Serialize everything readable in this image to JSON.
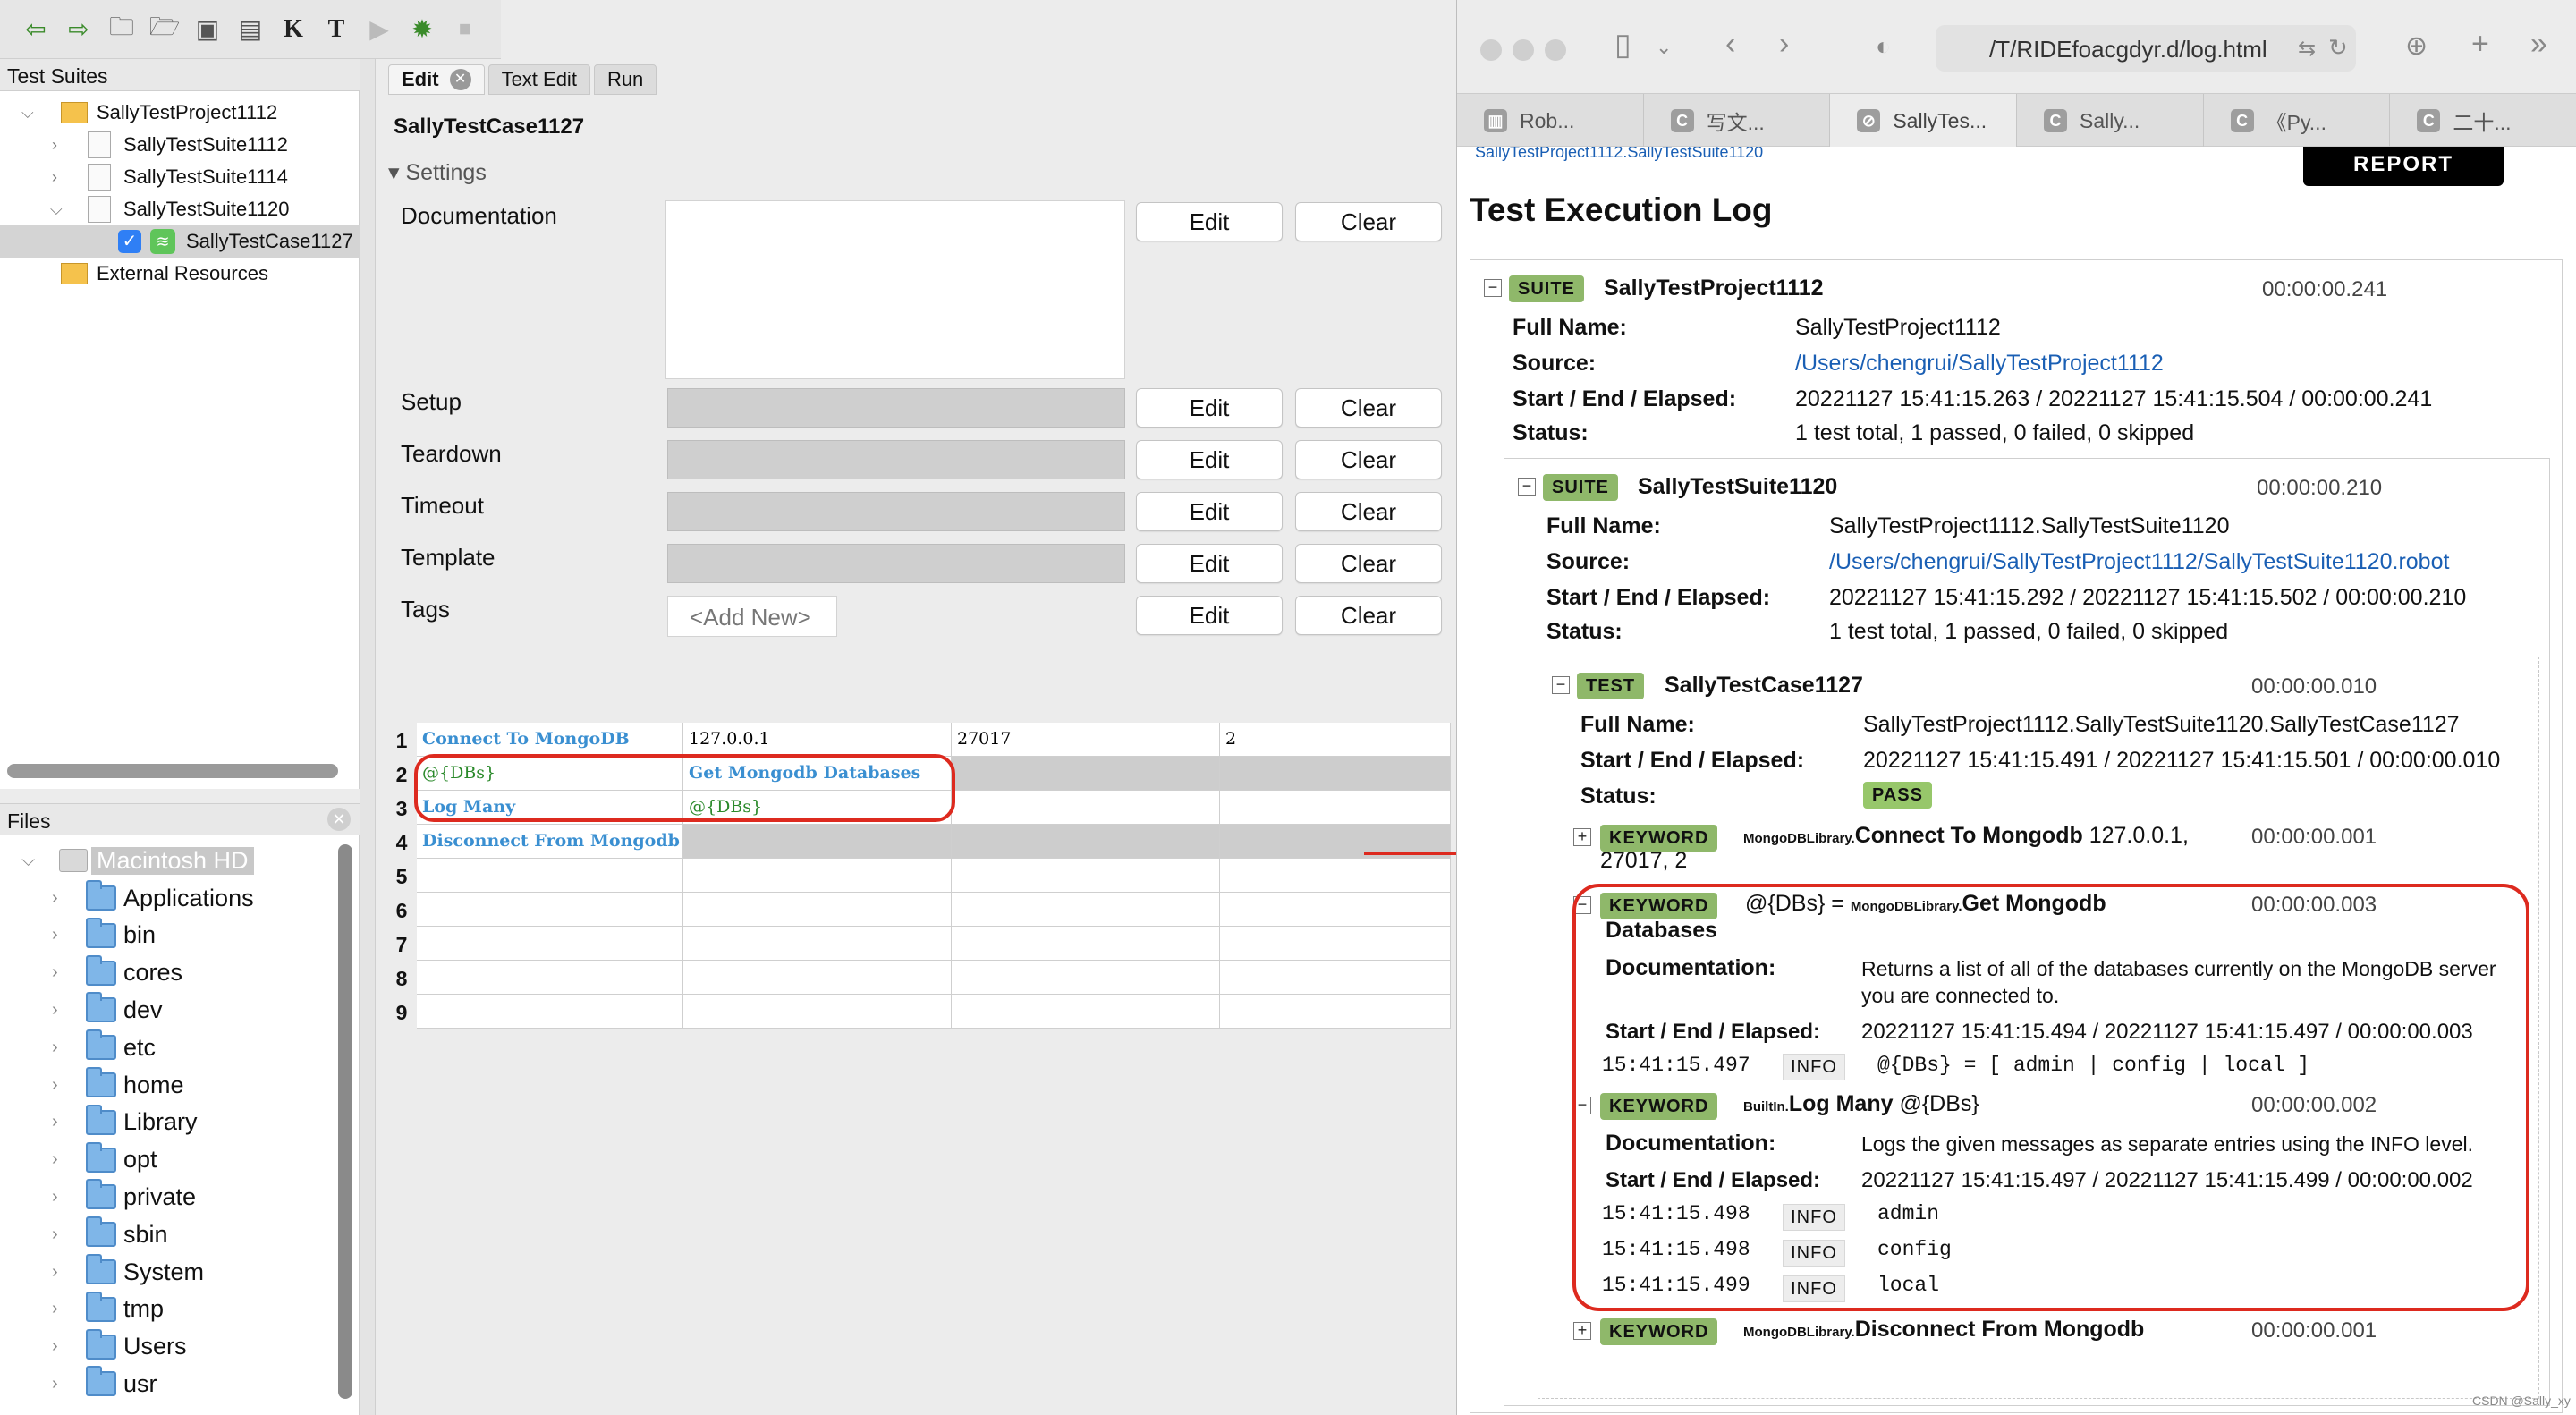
{
  "toolbar": {
    "icons": [
      "back-arrow-icon",
      "forward-arrow-icon",
      "open-folder-icon",
      "open-directory-icon",
      "save-icon",
      "save-all-icon",
      "keyword-search-icon",
      "text-format-icon",
      "play-icon",
      "debug-bug-icon",
      "stop-icon"
    ],
    "k_label": "K",
    "t_label": "T"
  },
  "test_suites": {
    "header": "Test Suites",
    "items": [
      {
        "label": "SallyTestProject1112",
        "level": 0
      },
      {
        "label": "SallyTestSuite1112",
        "level": 1
      },
      {
        "label": "SallyTestSuite1114",
        "level": 1
      },
      {
        "label": "SallyTestSuite1120",
        "level": 1
      },
      {
        "label": "SallyTestCase1127",
        "level": 2
      },
      {
        "label": "External Resources",
        "level": 0
      }
    ]
  },
  "files": {
    "header": "Files",
    "root": "Macintosh HD",
    "items": [
      "Applications",
      "bin",
      "cores",
      "dev",
      "etc",
      "home",
      "Library",
      "opt",
      "private",
      "sbin",
      "System",
      "tmp",
      "Users",
      "usr"
    ]
  },
  "editor": {
    "tabs": [
      "Edit",
      "Text Edit",
      "Run"
    ],
    "title": "SallyTestCase1127",
    "settings_label": "Settings",
    "settings": [
      "Documentation",
      "Setup",
      "Teardown",
      "Timeout",
      "Template",
      "Tags"
    ],
    "edit_label": "Edit",
    "clear_label": "Clear",
    "tags_placeholder": "<Add New>"
  },
  "grid": {
    "rows": [
      {
        "n": "1",
        "c": [
          {
            "t": "Connect To MongoDB",
            "s": "kw"
          },
          {
            "t": "127.0.0.1",
            "s": "num"
          },
          {
            "t": "27017",
            "s": "num"
          },
          {
            "t": "2",
            "s": "num"
          }
        ]
      },
      {
        "n": "2",
        "c": [
          {
            "t": "@{DBs}",
            "s": "var"
          },
          {
            "t": "Get Mongodb Databases",
            "s": "kw"
          },
          {
            "t": "",
            "s": "shade"
          },
          {
            "t": "",
            "s": "shade"
          }
        ]
      },
      {
        "n": "3",
        "c": [
          {
            "t": "Log Many",
            "s": "kw"
          },
          {
            "t": "@{DBs}",
            "s": "var"
          },
          {
            "t": "",
            "s": ""
          },
          {
            "t": "",
            "s": ""
          }
        ]
      },
      {
        "n": "4",
        "c": [
          {
            "t": "Disconnect From Mongodb",
            "s": "kw"
          },
          {
            "t": "",
            "s": "shade"
          },
          {
            "t": "",
            "s": "shade"
          },
          {
            "t": "",
            "s": "shade"
          }
        ]
      },
      {
        "n": "5",
        "c": []
      },
      {
        "n": "6",
        "c": []
      },
      {
        "n": "7",
        "c": []
      },
      {
        "n": "8",
        "c": []
      },
      {
        "n": "9",
        "c": []
      }
    ]
  },
  "browser": {
    "url": "/T/RIDEfoacgdyr.d/log.html",
    "tabs": [
      "Rob...",
      "写文...",
      "SallyTes...",
      "Sally...",
      "《Py...",
      "二十..."
    ]
  },
  "log": {
    "report_label": "REPORT",
    "top_link": "SallyTestProject1112.SallyTestSuite1120",
    "title": "Test Execution Log",
    "suite_badge": "SUITE",
    "test_badge": "TEST",
    "keyword_badge": "KEYWORD",
    "info_badge": "INFO",
    "pass_badge": "PASS",
    "k_full_name": "Full Name:",
    "k_source": "Source:",
    "k_start": "Start / End / Elapsed:",
    "k_status": "Status:",
    "k_doc": "Documentation:",
    "suite1": {
      "name": "SallyTestProject1112",
      "elapsed": "00:00:00.241",
      "full_name": "SallyTestProject1112",
      "source": "/Users/chengrui/SallyTestProject1112",
      "times": "20221127 15:41:15.263 / 20221127 15:41:15.504 / 00:00:00.241",
      "status": "1 test total, 1 passed, 0 failed, 0 skipped"
    },
    "suite2": {
      "name": "SallyTestSuite1120",
      "elapsed": "00:00:00.210",
      "full_name": "SallyTestProject1112.SallyTestSuite1120",
      "source": "/Users/chengrui/SallyTestProject1112/SallyTestSuite1120.robot",
      "times": "20221127 15:41:15.292 / 20221127 15:41:15.502 / 00:00:00.210",
      "status": "1 test total, 1 passed, 0 failed, 0 skipped"
    },
    "test": {
      "name": "SallyTestCase1127",
      "elapsed": "00:00:00.010",
      "full_name": "SallyTestProject1112.SallyTestSuite1120.SallyTestCase1127",
      "times": "20221127 15:41:15.491 / 20221127 15:41:15.501 / 00:00:00.010"
    },
    "kw1": {
      "lib": "MongoDBLibrary.",
      "name": "Connect To Mongodb",
      "args": "127.0.0.1,",
      "args2": "27017, 2",
      "elapsed": "00:00:00.001"
    },
    "kw2": {
      "assign": "@{DBs} =",
      "lib": "MongoDBLibrary.",
      "name": "Get Mongodb",
      "name2": "Databases",
      "elapsed": "00:00:00.003",
      "doc": "Returns a list of all of the databases currently on the MongoDB server",
      "doc2": "you are connected to.",
      "times": "20221127 15:41:15.494 / 20221127 15:41:15.497 / 00:00:00.003",
      "msg_time": "15:41:15.497",
      "msg": "@{DBs} = [ admin | config | local ]"
    },
    "kw3": {
      "lib": "BuiltIn.",
      "name": "Log Many",
      "args": "@{DBs}",
      "elapsed": "00:00:00.002",
      "doc": "Logs the given messages as separate entries using the INFO level.",
      "times": "20221127 15:41:15.497 / 20221127 15:41:15.499 / 00:00:00.002",
      "msgs": [
        {
          "t": "15:41:15.498",
          "m": "admin"
        },
        {
          "t": "15:41:15.498",
          "m": "config"
        },
        {
          "t": "15:41:15.499",
          "m": "local"
        }
      ]
    },
    "kw4": {
      "lib": "MongoDBLibrary.",
      "name": "Disconnect From Mongodb",
      "elapsed": "00:00:00.001"
    }
  },
  "watermark": "CSDN @Sally_xy",
  "colors": {
    "badge": "#8fb86a",
    "highlight": "#dd2a1f",
    "keyword": "#3a8fd1",
    "variable": "#2b8a2b",
    "link": "#1a5fb4"
  }
}
